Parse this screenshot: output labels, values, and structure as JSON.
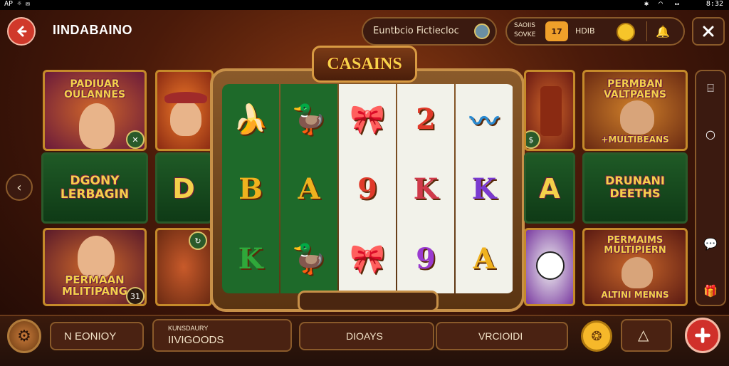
{
  "status_bar": {
    "left_text": "AP ☼ ✉",
    "time": "8:32"
  },
  "header": {
    "app_title": "IINDABAINO",
    "search_placeholder": "Euntbcio Fictiecloc",
    "info_label_line1": "SAOIIS",
    "info_label_line2": "SOVKE",
    "level_badge": "17",
    "balance": "HDIB"
  },
  "slot": {
    "logo": "CASAINS",
    "reels": [
      {
        "symbols": [
          "🍌",
          "B",
          "K"
        ],
        "colors": [
          "#e8b42a",
          "#f0b21e",
          "#2fa83a"
        ]
      },
      {
        "symbols": [
          "🦆",
          "A",
          "🦆"
        ],
        "colors": [
          "#e8c22a",
          "#f0b21e",
          "#e8b42a"
        ]
      },
      {
        "symbols": [
          "🎀",
          "9",
          "🎀"
        ],
        "colors": [
          "#2a9a3a",
          "#e03a2a",
          "#2a9a3a"
        ]
      },
      {
        "symbols": [
          "2",
          "K",
          "9"
        ],
        "colors": [
          "#e03a2a",
          "#d03a4a",
          "#9a3ad0"
        ]
      },
      {
        "symbols": [
          "〰",
          "K",
          "A"
        ],
        "colors": [
          "#2a8ad0",
          "#7a3ad0",
          "#f0b21e"
        ]
      }
    ]
  },
  "side_symbols": {
    "left_mid": "D",
    "right_mid": "A"
  },
  "tiles": {
    "top_left_title": "PADIUAR OULANNES",
    "mid_left_title": "DGONY LERBAGIN",
    "bottom_left_title": "PERMAAN MLITIPANG",
    "bottom_left_badge": "31",
    "top_right_title": "PERMBAN VALTPAENS",
    "top_right_subtitle": "+MULTIBEANS",
    "mid_right_title": "DRUNANI DEETHS",
    "bottom_right_title": "PERMAIMS MULTIPIERN",
    "bottom_right_subtitle": "ALTINI MENNS"
  },
  "bottom_bar": {
    "box1": "N EONIOY",
    "box2_line1": "KUNSDAURY",
    "box2_line2": "IIVIGOODS",
    "box3": "DIOAYS",
    "box4": "VRCIOIDI"
  }
}
